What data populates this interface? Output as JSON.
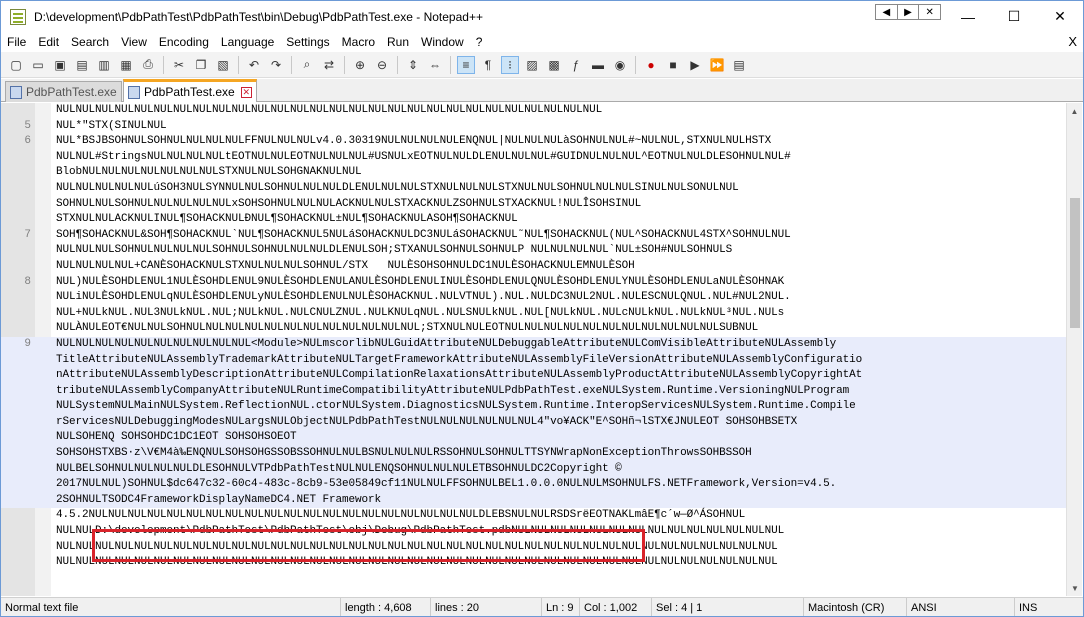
{
  "window": {
    "title": "D:\\development\\PdbPathTest\\PdbPathTest\\bin\\Debug\\PdbPathTest.exe - Notepad++",
    "minimize": "—",
    "maximize": "☐",
    "close": "✕",
    "mini_left": "◀",
    "mini_right": "▶",
    "mini_close": "✕"
  },
  "menu": [
    "File",
    "Edit",
    "Search",
    "View",
    "Encoding",
    "Language",
    "Settings",
    "Macro",
    "Run",
    "Window",
    "?"
  ],
  "menu_close": "X",
  "toolbar": {
    "icons": [
      "new-file",
      "open-file",
      "save",
      "save-all",
      "close",
      "close-all",
      "print",
      "cut",
      "copy",
      "paste",
      "undo",
      "redo",
      "find",
      "replace",
      "zoom-in",
      "zoom-out",
      "sync-vertical",
      "sync-horizontal",
      "word-wrap",
      "show-all-chars",
      "indent-guide",
      "user-lang",
      "doc-map",
      "function-list",
      "folder-workspace",
      "monitor",
      "record-macro",
      "stop-record",
      "play-macro",
      "run-multiple",
      "save-macro"
    ]
  },
  "tabs": [
    {
      "label": "PdbPathTest.exe",
      "active": false
    },
    {
      "label": "PdbPathTest.exe",
      "active": true
    }
  ],
  "editor": {
    "lines": [
      {
        "num": "",
        "text": "NULNULNULNULNULNULNULNULNULNULNULNULNULNULNULNULNULNULNULNULNULNULNULNULNULNULNULNUL",
        "sel": false
      },
      {
        "num": "5",
        "text": "NUL*\"STX(SINULNUL",
        "sel": false
      },
      {
        "num": "6",
        "text": "NUL*BSJBSOHNULSOHNULNULNULNULFFNULNULNULv4.0.30319NULNULNULNULENQNUL|NULNULNULàSOHNULNUL#~NULNUL,STXNULNULHSTX",
        "sel": false
      },
      {
        "num": "",
        "text": "NULNUL#StringsNULNULNULNULtEOTNULNULEOTNULNULNUL#USNULxEOTNULNULDLENULNULNUL#GUIDNULNULNUL^EOTNULNULDLESOHNULNUL#",
        "sel": false
      },
      {
        "num": "",
        "text": "BlobNULNULNULNULNULNULNULSTXNULNULSOHGNAKNULNUL",
        "sel": false
      },
      {
        "num": "",
        "text": "NULNULNULNULNULúSOH3NULSYNNULNULSOHNULNULNULDLENULNULNULSTXNULNULNULSTXNULNULSOHNULNULNULSINULNULSONULNUL",
        "sel": false
      },
      {
        "num": "",
        "text": "SOHNULNULSOHNULNULNULNULNULxSOHSOHNULNULNULACKNULNULSTXACKNULZSOHNULSTXACKNUL!NULÎSOHSINUL",
        "sel": false
      },
      {
        "num": "",
        "text": "STXNULNULACKNULINUL¶SOHACKNULÐNUL¶SOHACKNUL±NUL¶SOHACKNULASOH¶SOHACKNUL",
        "sel": false
      },
      {
        "num": "7",
        "text": "SOH¶SOHACKNUL&SOH¶SOHACKNUL`NUL¶SOHACKNUL5NULáSOHACKNULDC3NULáSOHACKNUL˜NUL¶SOHACKNUL(NUL^SOHACKNUL4STX^SOHNULNUL",
        "sel": false
      },
      {
        "num": "",
        "text": "NULNULNULSOHNULNULNULNULSOHNULSOHNULNULNULDLENULSOH;STXANULSOHNULSOHNULP NULNULNULNUL`NUL±SOH#NULSOHNULS",
        "sel": false
      },
      {
        "num": "",
        "text": "NULNULNULNUL+CANÈSOHACKNULSTXNULNULNULSOHNUL/STX   NULÈSOHSOHNULDC1NULÈSOHACKNULEMNULÈSOH",
        "sel": false
      },
      {
        "num": "8",
        "text": "NUL)NULÈSOHDLENUL1NULÈSOHDLENUL9NULÈSOHDLENULANULÈSOHDLENULINULÈSOHDLENULQNULÈSOHDLENULYNULÈSOHDLENULaNULÈSOHNAK",
        "sel": false
      },
      {
        "num": "",
        "text": "NULiNULÈSOHDLENULqNULÈSOHDLENULyNULÈSOHDLENULNULÈSOHACKNUL.NULVTNUL).NUL.NULDC3NUL2NUL.NULESCNULQNUL.NUL#NUL2NUL.",
        "sel": false
      },
      {
        "num": "",
        "text": "NUL+NULkNUL.NUL3NULkNUL.NUL;NULkNUL.NULCNULZNUL.NULKNULqNUL.NULSNULkNUL.NUL[NULkNUL.NULcNULkNUL.NULkNUL³NUL.NULs",
        "sel": false
      },
      {
        "num": "",
        "text": "NULÀNULEOT€NULNULSOHNULNULNULNULNULNULNULNULNULNULNULNUL;STXNULNULEOTNULNULNULNULNULNULNULNULNULNULNULSUBNUL",
        "sel": false
      },
      {
        "num": "9",
        "text": "NULNULNULNULNULNULNULNULNULNUL<Module>NULmscorlibNULGuidAttributeNULDebuggableAttributeNULComVisibleAttributeNULAssembly",
        "sel": true
      },
      {
        "num": "",
        "text": "TitleAttributeNULAssemblyTrademarkAttributeNULTargetFrameworkAttributeNULAssemblyFileVersionAttributeNULAssemblyConfiguratio",
        "sel": true
      },
      {
        "num": "",
        "text": "nAttributeNULAssemblyDescriptionAttributeNULCompilationRelaxationsAttributeNULAssemblyProductAttributeNULAssemblyCopyrightAt",
        "sel": true
      },
      {
        "num": "",
        "text": "tributeNULAssemblyCompanyAttributeNULRuntimeCompatibilityAttributeNULPdbPathTest.exeNULSystem.Runtime.VersioningNULProgram",
        "sel": true
      },
      {
        "num": "",
        "text": "NULSystemNULMainNULSystem.ReflectionNUL.ctorNULSystem.DiagnosticsNULSystem.Runtime.InteropServicesNULSystem.Runtime.Compile",
        "sel": true
      },
      {
        "num": "",
        "text": "rServicesNULDebuggingModesNULargsNULObjectNULPdbPathTestNULNULNULNULNULNUL4\"vo¥ACK\"E^SOHñ¬lSTX€JNULEOT SOHSOHBSETX",
        "sel": true
      },
      {
        "num": "",
        "text": "NULSOHENQ SOHSOHDC1DC1EOT SOHSOHSOEOT",
        "sel": true
      },
      {
        "num": "",
        "text": "SOHSOHSTXBS·z\\V€M4à‰ENQNULSOHSOHGSSOBSSOHNULNULBSNULNULNULRSSOHNULSOHNULTTSYNWrapNonExceptionThrowsSOHBSSOH",
        "sel": true
      },
      {
        "num": "",
        "text": "NULBELSOHNULNULNULNULDLESOHNULVTPdbPathTestNULNULENQSOHNULNULNULETBSOHNULDC2Copyright ©",
        "sel": true
      },
      {
        "num": "",
        "text": "2017NULNUL)SOHNUL$dc647c32-60c4-483c-8cb9-53e05849cf11NULNULFFSOHNULBEL1.0.0.0NULNULMSOHNULFS.NETFramework,Version=v4.5.",
        "sel": true
      },
      {
        "num": "",
        "text": "2SOHNULTSODC4FrameworkDisplayNameDC4.NET Framework",
        "sel": true
      },
      {
        "num": "",
        "text": "4.5.2NULNULNULNULNULNULNULNULNULNULNULNULNULNULNULNULNULNULNULNULDLEBSNULNULRSDSrëEOTNAKLmâE¶c´w—Ø^ÁSOHNUL",
        "sel": false
      },
      {
        "num": "",
        "text": "NULNULD:\\development\\PdbPathTest\\PdbPathTest\\obj\\Debug\\PdbPathTest.pdbNULNULNULNULNULNULNULNULNULNULNULNULNULNUL",
        "sel": false
      },
      {
        "num": "",
        "text": "NULNULNULNULNULNULNULNULNULNULNULNULNULNULNULNULNULNULNULNULNULNULNULNULNULNULNULNULNULNULNULNULNULNULNULNULNUL",
        "sel": false
      },
      {
        "num": "",
        "text": "NULNULNULNULNULNULNULNULNULNULNULNULNULNULNULNULNULNULNULNULNULNULNULNULNULNULNULNULNULNULNULNULNULNULNULNULNUL",
        "sel": false
      }
    ]
  },
  "status": {
    "file_type": "Normal text file",
    "length": "length : 4,608",
    "lines": "lines : 20",
    "ln": "Ln : 9",
    "col": "Col : 1,002",
    "sel": "Sel : 4 | 1",
    "eol": "Macintosh (CR)",
    "encoding": "ANSI",
    "mode": "INS"
  }
}
